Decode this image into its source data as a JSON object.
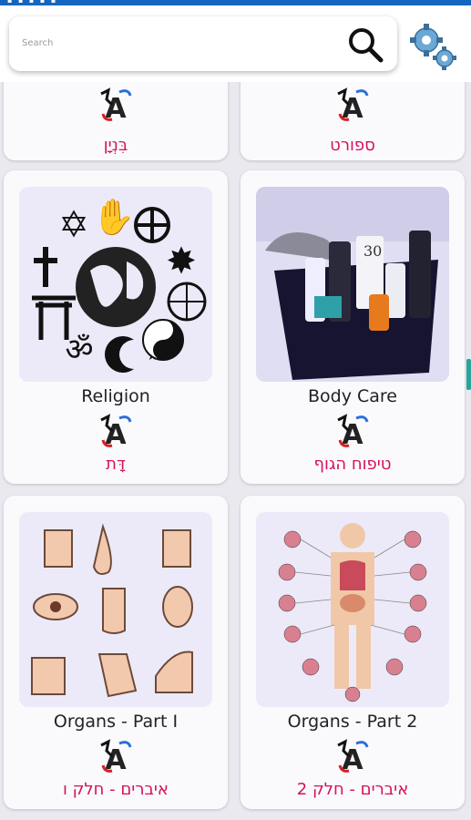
{
  "search": {
    "placeholder": "Search"
  },
  "icons": {
    "search": "search-icon",
    "settings": "gear-icon",
    "logo": "running-letter-a-logo"
  },
  "categories": [
    {
      "en": "",
      "he": "בִּנְיָן"
    },
    {
      "en": "",
      "he": "ספורט"
    },
    {
      "en": "Religion",
      "he": "דָּת"
    },
    {
      "en": "Body Care",
      "he": "טיפוח הגוף"
    },
    {
      "en": "Organs - Part I",
      "he": "איברים - חלק ו"
    },
    {
      "en": "Organs - Part 2",
      "he": "איברים - חלק 2"
    }
  ],
  "colors": {
    "status_bar": "#1565c0",
    "hebrew_text": "#d6105e",
    "accent_scroll": "#26a69a"
  }
}
